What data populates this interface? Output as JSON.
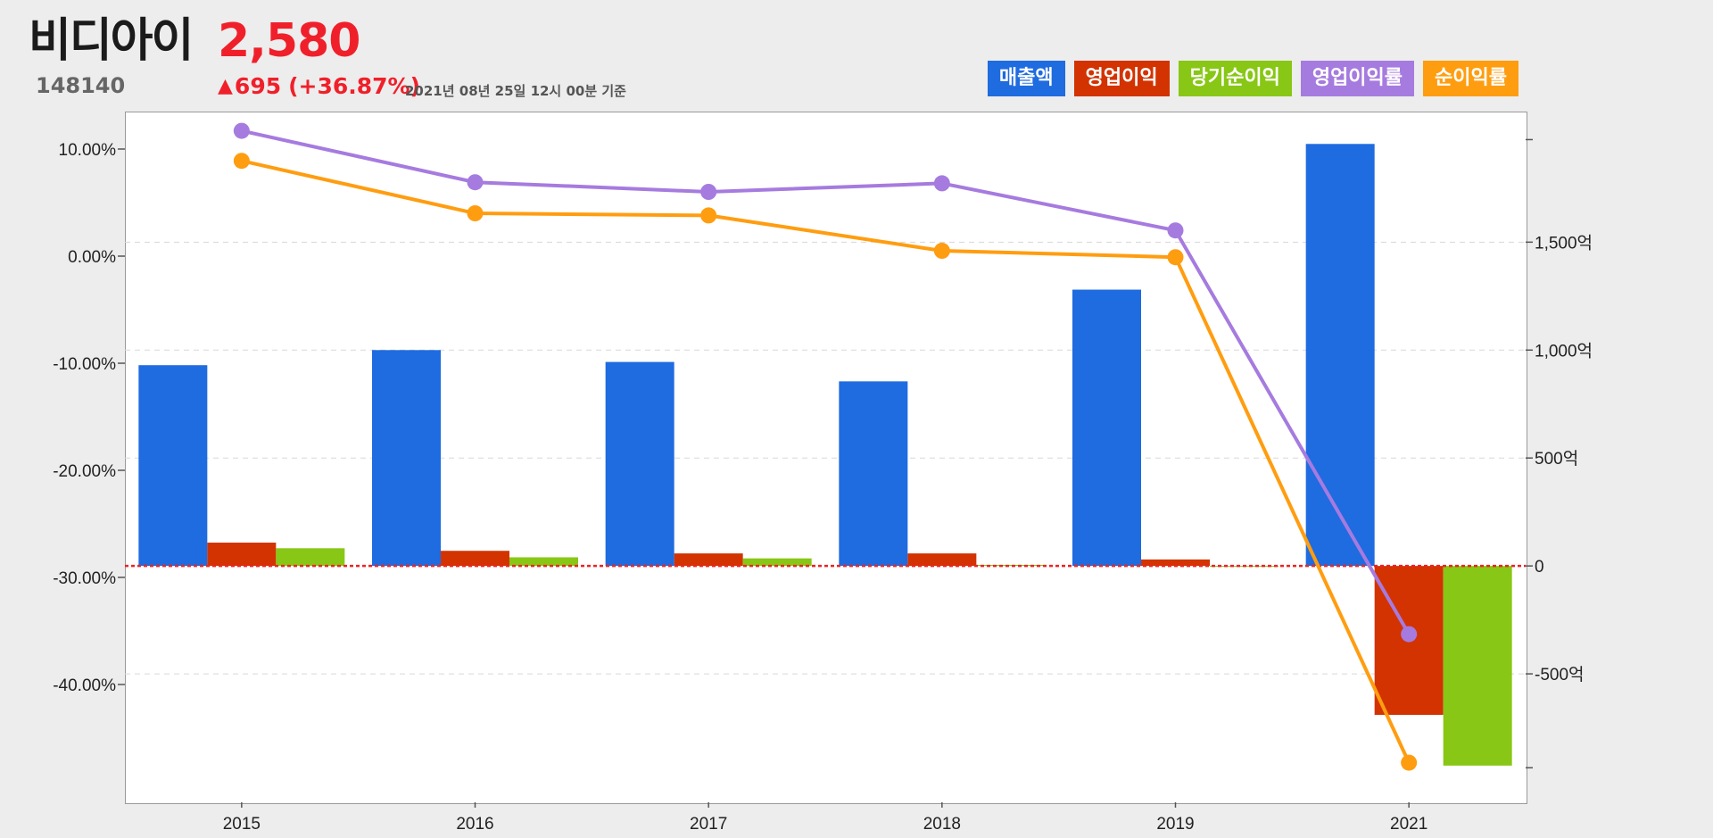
{
  "header": {
    "name": "비디아이",
    "price": "2,580",
    "code": "148140",
    "change_arrow": "▲",
    "change": "695",
    "change_pct": "(+36.87%)",
    "date": "2021년 08년 25일 12시 00분 기준"
  },
  "legend": [
    {
      "label": "매출액",
      "color": "#1f6be0"
    },
    {
      "label": "영업이익",
      "color": "#d23300"
    },
    {
      "label": "당기순이익",
      "color": "#88c715"
    },
    {
      "label": "영업이익률",
      "color": "#a67bdf"
    },
    {
      "label": "순이익률",
      "color": "#ff9d10"
    }
  ],
  "chart_data": {
    "type": "bar",
    "categories": [
      "2015",
      "2016",
      "2017",
      "2018",
      "2019",
      "2021"
    ],
    "series": [
      {
        "name": "매출액",
        "type": "bar",
        "axis": "right",
        "color": "#1f6be0",
        "values": [
          930,
          1000,
          945,
          855,
          1280,
          1955
        ]
      },
      {
        "name": "영업이익",
        "type": "bar",
        "axis": "right",
        "color": "#d23300",
        "values": [
          108,
          70,
          58,
          58,
          30,
          -690
        ]
      },
      {
        "name": "당기순이익",
        "type": "bar",
        "axis": "right",
        "color": "#88c715",
        "values": [
          82,
          40,
          35,
          5,
          0,
          -925
        ]
      },
      {
        "name": "영업이익률",
        "type": "line",
        "axis": "left",
        "color": "#a67bdf",
        "values": [
          11.7,
          6.9,
          6.0,
          6.8,
          2.4,
          -35.3
        ]
      },
      {
        "name": "순이익률",
        "type": "line",
        "axis": "left",
        "color": "#ff9d10",
        "values": [
          8.9,
          4.0,
          3.8,
          0.5,
          -0.1,
          -47.3
        ]
      }
    ],
    "left_axis": {
      "range": [
        -51.0,
        13.5
      ],
      "ticks": [
        10,
        0,
        -10,
        -20,
        -30,
        -40
      ],
      "tick_labels": [
        "10.00%",
        "0.00%",
        "-10.00%",
        "-20.00%",
        "-30.00%",
        "-40.00%"
      ]
    },
    "right_axis": {
      "range": [
        -1095,
        2105
      ],
      "ticks": [
        1500,
        1000,
        500,
        0,
        -500
      ],
      "tick_labels": [
        "1,500억",
        "1,000억",
        "500억",
        "0",
        "-500억"
      ],
      "extra_ticks": [
        1975,
        -935
      ]
    },
    "zero_line_color": "#ee2222",
    "grid": "dashed horizontal"
  }
}
